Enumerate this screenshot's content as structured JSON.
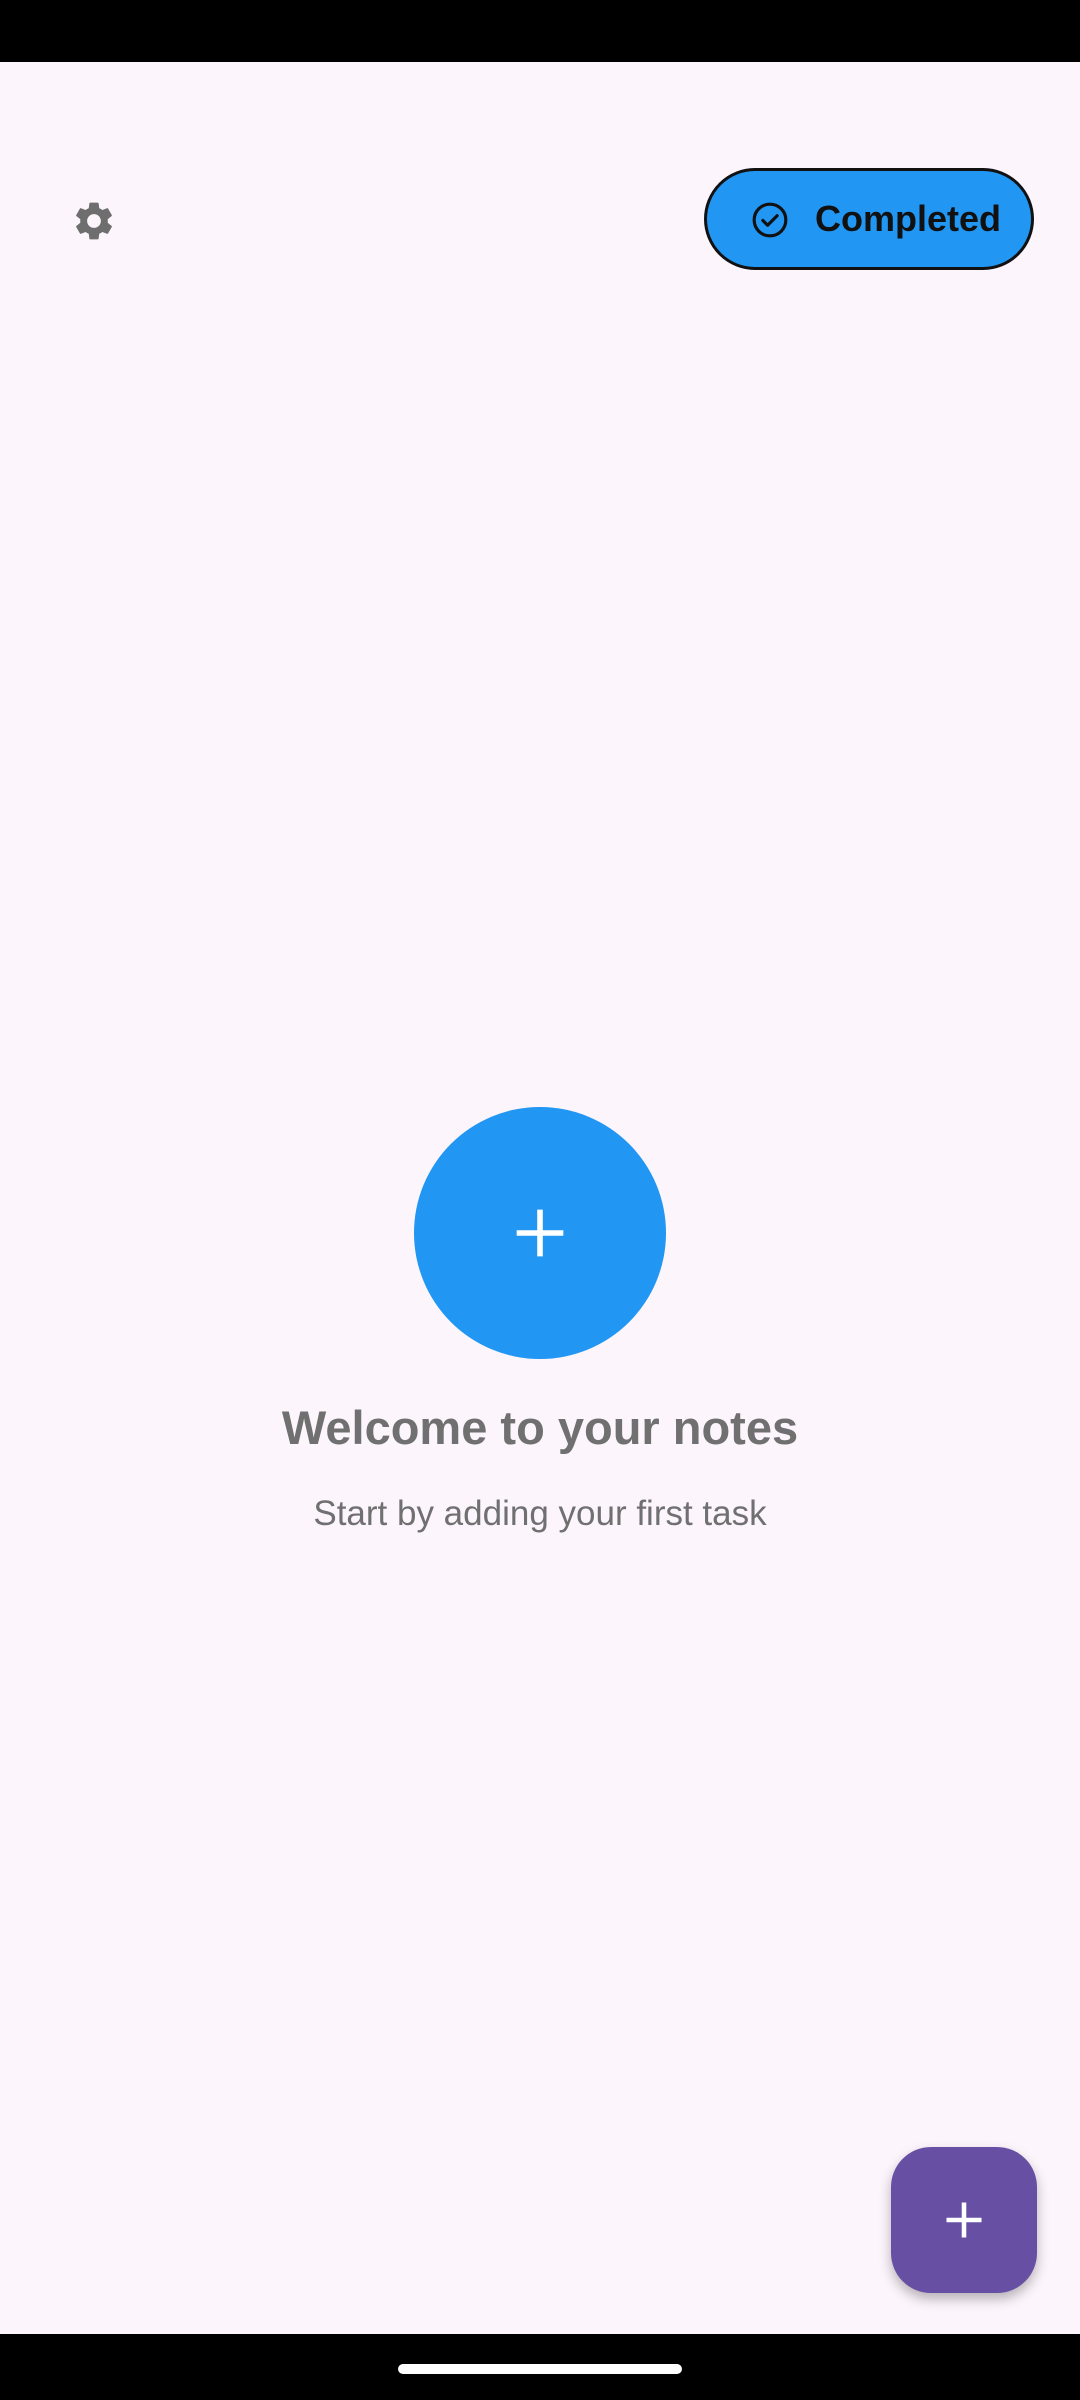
{
  "colors": {
    "background": "#FCF5FC",
    "accent_blue": "#2196F3",
    "fab_purple": "#6750A4",
    "muted_text": "#707070",
    "icon_gray": "#6E6E6E",
    "system_bars": "#000000"
  },
  "header": {
    "settings_icon": "gear-icon",
    "filter_button": {
      "label": "Completed",
      "icon": "check-circle-icon"
    }
  },
  "empty_state": {
    "add_icon": "plus-icon",
    "title": "Welcome to your notes",
    "subtitle": "Start by adding your first task"
  },
  "fab": {
    "icon": "plus-icon"
  }
}
